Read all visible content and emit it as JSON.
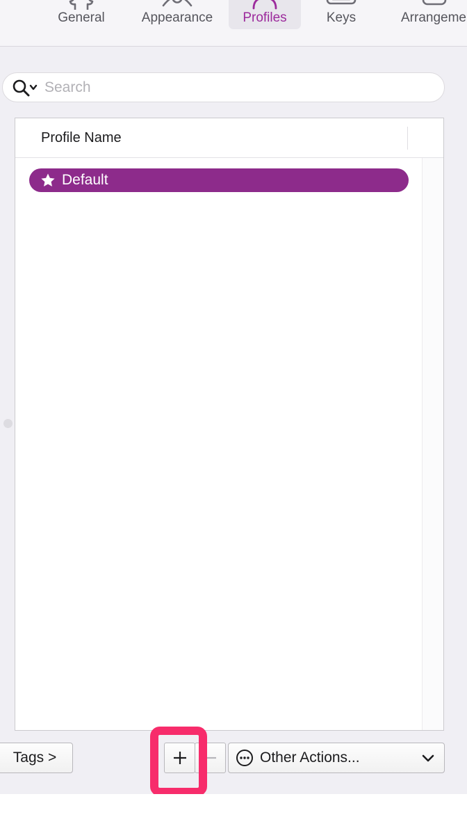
{
  "window": {
    "background_color": "#f0eff4"
  },
  "toolbar": {
    "tabs": [
      {
        "id": "general",
        "label": "General",
        "icon": "gear-icon",
        "selected": false
      },
      {
        "id": "appearance",
        "label": "Appearance",
        "icon": "eye-icon",
        "selected": false
      },
      {
        "id": "profiles",
        "label": "Profiles",
        "icon": "profile-icon",
        "selected": true
      },
      {
        "id": "keys",
        "label": "Keys",
        "icon": "keyboard-icon",
        "selected": false
      },
      {
        "id": "arrangement",
        "label": "Arrangeme",
        "icon": "arrangement-icon",
        "selected": false
      }
    ],
    "selected_tab_color": "#9c2a9c",
    "unselected_tab_color": "#55555c"
  },
  "search": {
    "value": "",
    "placeholder": "Search",
    "icon": "search-icon",
    "dropdown_icon": "chevron-down-icon"
  },
  "table": {
    "columns": [
      "Profile Name"
    ],
    "rows": [
      {
        "name": "Default",
        "badge_icon": "star-icon",
        "selected": true
      }
    ],
    "selected_row_color": "#8d2b8b"
  },
  "bottom_bar": {
    "tags_label": "Tags >",
    "add_label": "+",
    "remove_label": "−",
    "remove_enabled": false,
    "other_actions_label": "Other Actions...",
    "other_actions_icon": "ellipsis-circle-icon",
    "other_actions_chevron": "chevron-down-icon"
  },
  "annotation": {
    "highlight_color": "#f72c6b",
    "target": "add-button"
  }
}
